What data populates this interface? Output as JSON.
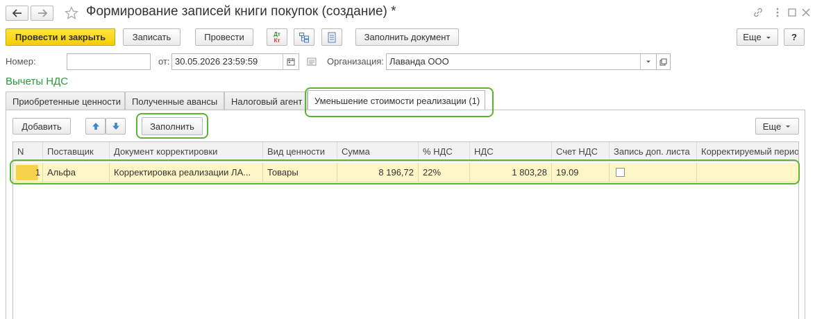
{
  "window": {
    "title": "Формирование записей книги покупок (создание) *"
  },
  "toolbar": {
    "post_close": "Провести и закрыть",
    "save": "Записать",
    "post": "Провести",
    "dt_kt_top": "Дт",
    "dt_kt_bottom": "Кт",
    "fill_document": "Заполнить документ",
    "more": "Еще",
    "help": "?"
  },
  "header_fields": {
    "number_label": "Номер:",
    "number_value": "",
    "date_label": "от:",
    "date_value": "30.05.2026 23:59:59",
    "org_label": "Организация:",
    "org_value": "Лаванда ООО"
  },
  "section_title": "Вычеты НДС",
  "tabs": [
    {
      "label": "Приобретенные ценности"
    },
    {
      "label": "Полученные авансы"
    },
    {
      "label": "Налоговый агент"
    },
    {
      "label": "Уменьшение стоимости реализации (1)"
    }
  ],
  "table_toolbar": {
    "add": "Добавить",
    "fill": "Заполнить",
    "more": "Еще"
  },
  "table": {
    "columns": [
      "N",
      "Поставщик",
      "Документ корректировки",
      "Вид ценности",
      "Сумма",
      "% НДС",
      "НДС",
      "Счет НДС",
      "Запись доп. листа",
      "Корректируемый период"
    ],
    "rows": [
      {
        "n": "1",
        "supplier": "Альфа",
        "document": "Корректировка реализации ЛА...",
        "value_type": "Товары",
        "sum": "8 196,72",
        "vat_rate": "22%",
        "vat": "1 803,28",
        "vat_account": "19.09",
        "extra_sheet": false,
        "period": ""
      }
    ]
  },
  "colors": {
    "accent_green": "#5cb531",
    "primary_yellow": "#f5cd00",
    "row_selected": "#fff6c8",
    "section_title": "#2a9a3c"
  }
}
